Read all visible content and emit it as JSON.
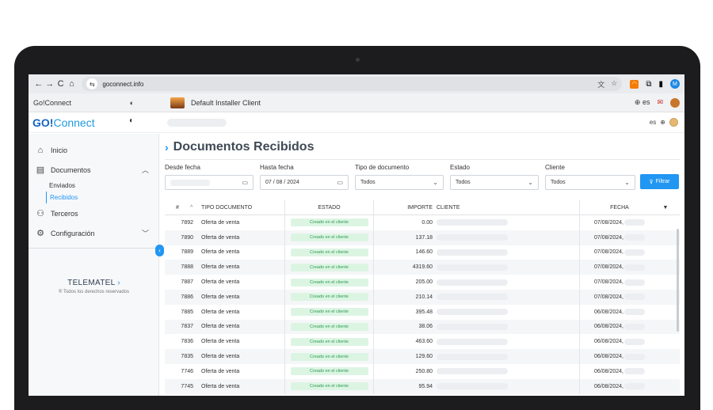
{
  "browser": {
    "url": "goconnect.info",
    "back": "←",
    "forward": "→",
    "reload": "C",
    "home": "⌂"
  },
  "appbar": {
    "brand": "Go!Connect",
    "client": "Default Installer Client",
    "lang": "es"
  },
  "header": {
    "logo_go": "GO!",
    "logo_connect": "Connect",
    "lang": "es"
  },
  "sidebar": {
    "items": [
      {
        "label": "Inicio",
        "icon": "home-icon"
      },
      {
        "label": "Documentos",
        "icon": "document-icon"
      },
      {
        "label": "Terceros",
        "icon": "users-icon"
      },
      {
        "label": "Configuración",
        "icon": "gear-icon"
      }
    ],
    "sub_enviados": "Enviados",
    "sub_recibidos": "Recibidos",
    "footer_logo": "TELEMATEL",
    "footer_copy": "® Todos los derechos reservados"
  },
  "page": {
    "title": "Documentos Recibidos"
  },
  "filters": {
    "desde_label": "Desde fecha",
    "hasta_label": "Hasta fecha",
    "hasta_value": "07 / 08 / 2024",
    "tipo_label": "Tipo de documento",
    "tipo_value": "Todos",
    "estado_label": "Estado",
    "estado_value": "Todos",
    "cliente_label": "Cliente",
    "cliente_value": "Todos",
    "button": "Filtrar"
  },
  "table": {
    "headers": {
      "num": "#",
      "tipo": "TIPO DOCUMENTO",
      "estado": "ESTADO",
      "importe": "IMPORTE",
      "cliente": "CLIENTE",
      "fecha": "FECHA"
    },
    "rows": [
      {
        "num": "7892",
        "tipo": "Oferta de venta",
        "estado": "Creado en el cliente",
        "importe": "0.00",
        "fecha": "07/08/2024,"
      },
      {
        "num": "7890",
        "tipo": "Oferta de venta",
        "estado": "Creado en el cliente",
        "importe": "137.18",
        "fecha": "07/08/2024,"
      },
      {
        "num": "7889",
        "tipo": "Oferta de venta",
        "estado": "Creado en el cliente",
        "importe": "146.60",
        "fecha": "07/08/2024,"
      },
      {
        "num": "7888",
        "tipo": "Oferta de venta",
        "estado": "Creado en el cliente",
        "importe": "4319.60",
        "fecha": "07/08/2024,"
      },
      {
        "num": "7887",
        "tipo": "Oferta de venta",
        "estado": "Creado en el cliente",
        "importe": "205.00",
        "fecha": "07/08/2024,"
      },
      {
        "num": "7886",
        "tipo": "Oferta de venta",
        "estado": "Creado en el cliente",
        "importe": "210.14",
        "fecha": "07/08/2024,"
      },
      {
        "num": "7885",
        "tipo": "Oferta de venta",
        "estado": "Creado en el cliente",
        "importe": "395.48",
        "fecha": "06/08/2024,"
      },
      {
        "num": "7837",
        "tipo": "Oferta de venta",
        "estado": "Creado en el cliente",
        "importe": "38.06",
        "fecha": "06/08/2024,"
      },
      {
        "num": "7836",
        "tipo": "Oferta de venta",
        "estado": "Creado en el cliente",
        "importe": "463.60",
        "fecha": "06/08/2024,"
      },
      {
        "num": "7835",
        "tipo": "Oferta de venta",
        "estado": "Creado en el cliente",
        "importe": "129.60",
        "fecha": "06/08/2024,"
      },
      {
        "num": "7746",
        "tipo": "Oferta de venta",
        "estado": "Creado en el cliente",
        "importe": "250.80",
        "fecha": "06/08/2024,"
      },
      {
        "num": "7745",
        "tipo": "Oferta de venta",
        "estado": "Creado en el cliente",
        "importe": "95.94",
        "fecha": "06/08/2024,"
      }
    ]
  },
  "colors": {
    "accent": "#2196f3",
    "badge_bg": "#dcf5e3",
    "badge_text": "#2e9a50"
  }
}
